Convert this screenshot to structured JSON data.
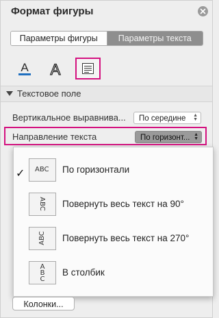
{
  "panel": {
    "title": "Формат фигуры"
  },
  "tabs": [
    {
      "label": "Параметры фигуры",
      "active": false
    },
    {
      "label": "Параметры текста",
      "active": true
    }
  ],
  "toolbar": {
    "fill_icon": "text-fill-icon",
    "outline_icon": "text-outline-icon",
    "textbox_icon": "textbox-icon",
    "accent_color": "#d3117f",
    "fill_color": "#1f6fbf"
  },
  "section": {
    "label": "Текстовое поле"
  },
  "fields": {
    "vertical_align": {
      "label": "Вертикальное выравнива...",
      "value": "По середине"
    },
    "text_direction": {
      "label": "Направление текста",
      "value": "По горизонт..."
    }
  },
  "dropdown": {
    "options": [
      {
        "label": "По горизонтали",
        "sample": "ABC",
        "selected": true
      },
      {
        "label": "Повернуть весь текст на 90°",
        "sample": "ABC",
        "selected": false
      },
      {
        "label": "Повернуть весь текст на 270°",
        "sample": "ABC",
        "selected": false
      },
      {
        "label": "В столбик",
        "sample": "A B C",
        "selected": false
      }
    ]
  },
  "columns_button": {
    "label": "Колонки..."
  }
}
